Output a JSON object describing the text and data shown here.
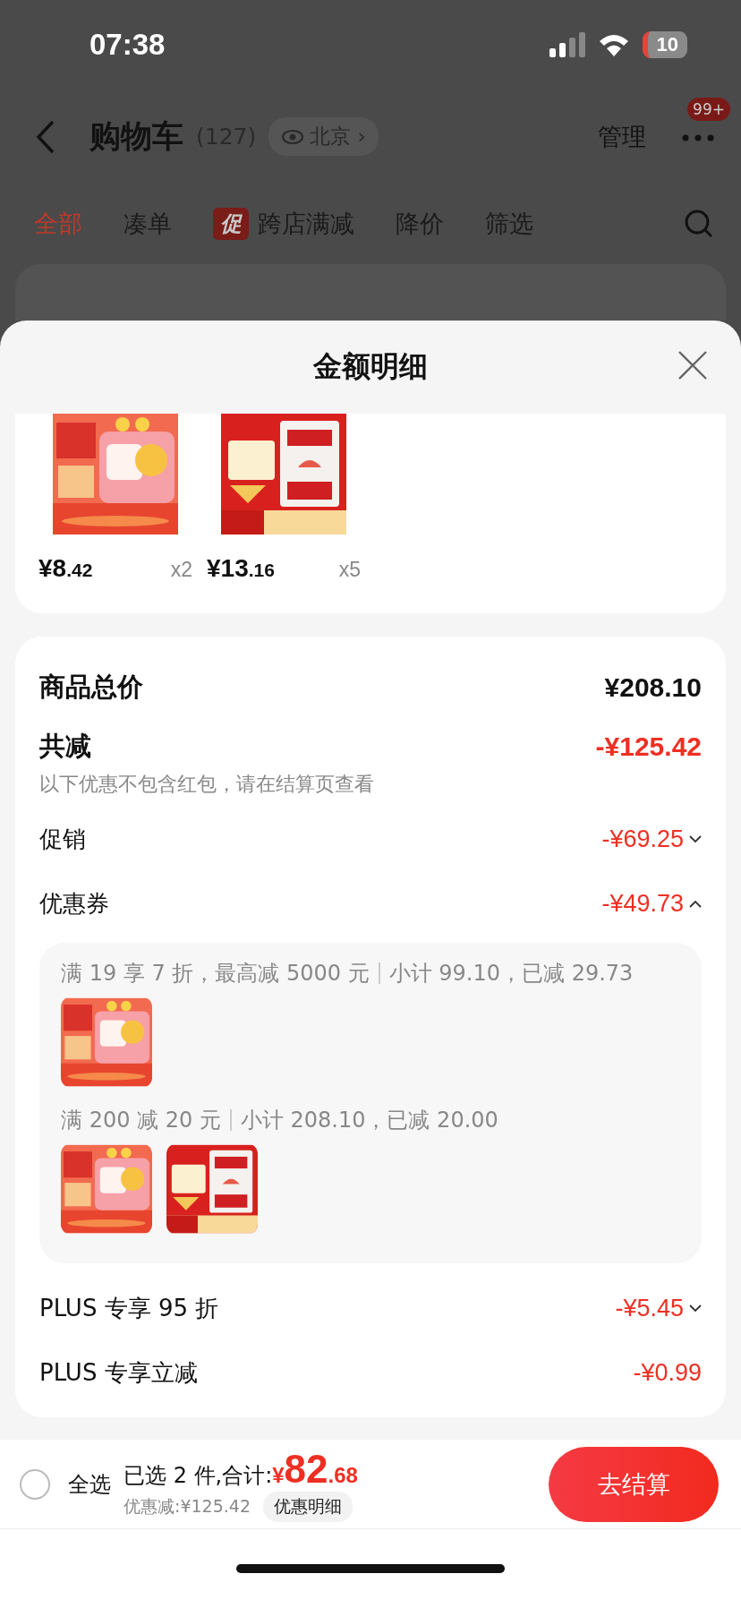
{
  "status_bar": {
    "time": "07:38",
    "battery": "10"
  },
  "header": {
    "title": "购物车",
    "count": "(127)",
    "location": "北京",
    "location_arrow": "›",
    "manage": "管理",
    "badge": "99+"
  },
  "tabs": [
    {
      "label": "全部",
      "selected": true
    },
    {
      "label": "凑单",
      "selected": false
    },
    {
      "label": "跨店满减",
      "tag": "促",
      "selected": false
    },
    {
      "label": "降价",
      "selected": false
    },
    {
      "label": "筛选",
      "selected": false
    }
  ],
  "sheet": {
    "title": "金额明细",
    "items": [
      {
        "kind": "picture",
        "price": {
          "main": "¥8",
          "cents": ".42"
        },
        "qty": "x2"
      },
      {
        "kind": "picture",
        "price": {
          "main": "¥13",
          "cents": ".16"
        },
        "qty": "x5"
      }
    ],
    "total": {
      "label": "商品总价",
      "value": "¥208.10"
    },
    "reduction": {
      "label": "共减",
      "value": "-¥125.42",
      "note": "以下优惠不包含红包，请在结算页查看"
    },
    "discounts": [
      {
        "kind": "expandable",
        "label": "促销",
        "value": "-¥69.25",
        "expanded": false
      },
      {
        "kind": "expandable",
        "label": "优惠券",
        "value": "-¥49.73",
        "expanded": true,
        "groups": [
          {
            "rule": "满 19 享 7 折，最高减 5000 元",
            "summary": "小计 99.10，已减 29.73"
          },
          {
            "rule": "满 200 减 20 元",
            "summary": "小计 208.10，已减 20.00"
          }
        ]
      },
      {
        "kind": "expandable",
        "label": "PLUS 专享 95 折",
        "value": "-¥5.45",
        "expanded": false
      },
      {
        "kind": "plain",
        "label": "PLUS 专享立减",
        "value": "-¥0.99"
      }
    ]
  },
  "bottom_bar": {
    "select_all": {
      "label": "全选",
      "checked": false
    },
    "selected_text": "已选 2 件,合计:",
    "total": {
      "currency": "¥",
      "main": "82",
      "cents": ".68"
    },
    "saving": "优惠减:¥125.42",
    "detail_button": "优惠明细",
    "checkout": "去结算"
  }
}
